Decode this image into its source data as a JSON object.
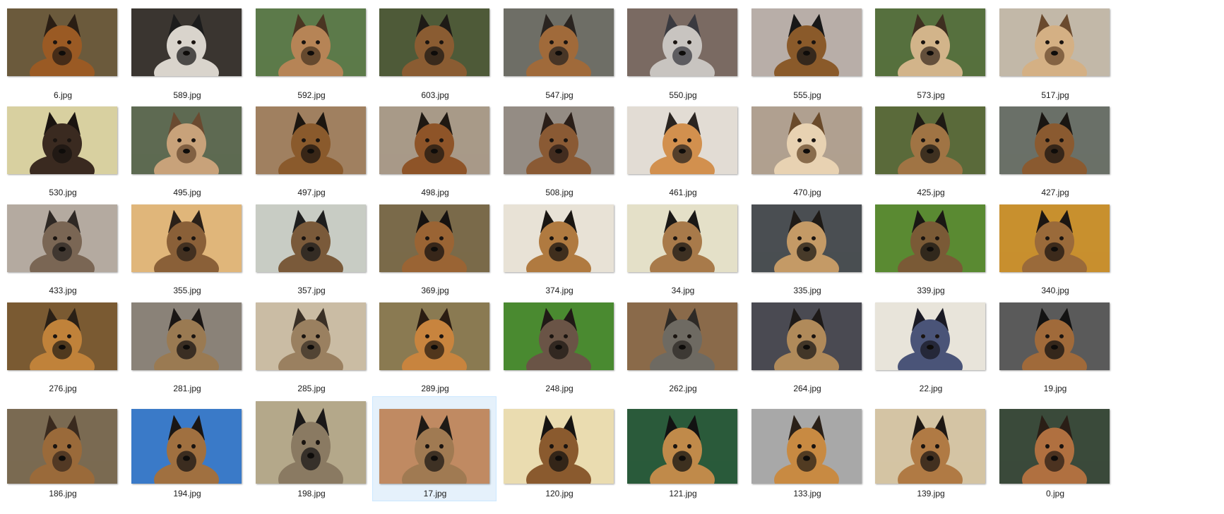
{
  "files": [
    {
      "name": "6.jpg",
      "bg": "#6b5a3c",
      "coat": "#9a5a24",
      "dark": "#2a1e14",
      "selected": false
    },
    {
      "name": "589.jpg",
      "bg": "#3a3530",
      "coat": "#d9d4cc",
      "dark": "#1c1c1c",
      "selected": false
    },
    {
      "name": "592.jpg",
      "bg": "#5c7a4a",
      "coat": "#b68456",
      "dark": "#4a3522",
      "selected": false
    },
    {
      "name": "603.jpg",
      "bg": "#4e5a38",
      "coat": "#8a5c32",
      "dark": "#1e1a16",
      "selected": false
    },
    {
      "name": "547.jpg",
      "bg": "#6e6e66",
      "coat": "#a06a3a",
      "dark": "#2a2420",
      "selected": false
    },
    {
      "name": "550.jpg",
      "bg": "#7a6a62",
      "coat": "#c8c4c0",
      "dark": "#3a3a40",
      "selected": false
    },
    {
      "name": "555.jpg",
      "bg": "#b8aea8",
      "coat": "#8a5a2a",
      "dark": "#181818",
      "selected": false
    },
    {
      "name": "573.jpg",
      "bg": "#56703e",
      "coat": "#d2b48a",
      "dark": "#3e2e20",
      "selected": false
    },
    {
      "name": "517.jpg",
      "bg": "#c2b8a8",
      "coat": "#d4b084",
      "dark": "#6a4a2e",
      "selected": false
    },
    {
      "name": "530.jpg",
      "bg": "#d8d0a0",
      "coat": "#3a2a20",
      "dark": "#1a1410",
      "selected": false
    },
    {
      "name": "495.jpg",
      "bg": "#5e6a52",
      "coat": "#c8a27a",
      "dark": "#6a4a30",
      "selected": false
    },
    {
      "name": "497.jpg",
      "bg": "#a08060",
      "coat": "#8a5a2c",
      "dark": "#1c1610",
      "selected": false
    },
    {
      "name": "498.jpg",
      "bg": "#a89a88",
      "coat": "#8e5428",
      "dark": "#1e1812",
      "selected": false
    },
    {
      "name": "508.jpg",
      "bg": "#948c84",
      "coat": "#8a5a34",
      "dark": "#2a1e18",
      "selected": false
    },
    {
      "name": "461.jpg",
      "bg": "#e2dcd4",
      "coat": "#d2904e",
      "dark": "#2a2420",
      "selected": false
    },
    {
      "name": "470.jpg",
      "bg": "#b0a090",
      "coat": "#e8d2b2",
      "dark": "#6a4a2a",
      "selected": false
    },
    {
      "name": "425.jpg",
      "bg": "#5a6a3a",
      "coat": "#a07444",
      "dark": "#1e1a14",
      "selected": false
    },
    {
      "name": "427.jpg",
      "bg": "#6a7068",
      "coat": "#8a5a30",
      "dark": "#1a1612",
      "selected": false
    },
    {
      "name": "433.jpg",
      "bg": "#b4aaa0",
      "coat": "#7a6654",
      "dark": "#2e2824",
      "selected": false
    },
    {
      "name": "355.jpg",
      "bg": "#e0b67a",
      "coat": "#8a6038",
      "dark": "#2a2018",
      "selected": false
    },
    {
      "name": "357.jpg",
      "bg": "#c8ccc4",
      "coat": "#7a5a3a",
      "dark": "#1e1e1e",
      "selected": false
    },
    {
      "name": "369.jpg",
      "bg": "#7a6a4a",
      "coat": "#9a6434",
      "dark": "#161210",
      "selected": false
    },
    {
      "name": "374.jpg",
      "bg": "#e8e2d6",
      "coat": "#b07a40",
      "dark": "#1a1612",
      "selected": false
    },
    {
      "name": "34.jpg",
      "bg": "#e4e0c8",
      "coat": "#a87a4a",
      "dark": "#1a1816",
      "selected": false
    },
    {
      "name": "335.jpg",
      "bg": "#4a4e52",
      "coat": "#c49a66",
      "dark": "#1e1a16",
      "selected": false
    },
    {
      "name": "339.jpg",
      "bg": "#5a8a32",
      "coat": "#7a5a36",
      "dark": "#1a1814",
      "selected": false
    },
    {
      "name": "340.jpg",
      "bg": "#c8902e",
      "coat": "#9a6a3a",
      "dark": "#1c1612",
      "selected": false
    },
    {
      "name": "276.jpg",
      "bg": "#7a5a32",
      "coat": "#c0823a",
      "dark": "#2a2016",
      "selected": false
    },
    {
      "name": "281.jpg",
      "bg": "#8a8278",
      "coat": "#9a7a52",
      "dark": "#1a1614",
      "selected": false
    },
    {
      "name": "285.jpg",
      "bg": "#cabca4",
      "coat": "#9a8060",
      "dark": "#3a3026",
      "selected": false
    },
    {
      "name": "289.jpg",
      "bg": "#8a7a52",
      "coat": "#c8843e",
      "dark": "#2a1c12",
      "selected": false
    },
    {
      "name": "248.jpg",
      "bg": "#4a8a30",
      "coat": "#6a5446",
      "dark": "#201a16",
      "selected": false
    },
    {
      "name": "262.jpg",
      "bg": "#8a6a4a",
      "coat": "#6e6a62",
      "dark": "#2e2a26",
      "selected": false
    },
    {
      "name": "264.jpg",
      "bg": "#4a4a52",
      "coat": "#b08a5a",
      "dark": "#1e1a18",
      "selected": false
    },
    {
      "name": "22.jpg",
      "bg": "#e8e4da",
      "coat": "#4a5478",
      "dark": "#1a1a24",
      "selected": false
    },
    {
      "name": "19.jpg",
      "bg": "#5a5a5a",
      "coat": "#a06a3a",
      "dark": "#121212",
      "selected": false
    },
    {
      "name": "186.jpg",
      "bg": "#7a6a52",
      "coat": "#9a6a3a",
      "dark": "#3a2a1e",
      "selected": false
    },
    {
      "name": "194.jpg",
      "bg": "#3a7ac8",
      "coat": "#a07040",
      "dark": "#1a1614",
      "selected": false
    },
    {
      "name": "198.jpg",
      "bg": "#b4a88a",
      "coat": "#8a7a62",
      "dark": "#1a1818",
      "selected": false
    },
    {
      "name": "17.jpg",
      "bg": "#c08a62",
      "coat": "#a07a52",
      "dark": "#1e1a16",
      "selected": true
    },
    {
      "name": "120.jpg",
      "bg": "#eadcb0",
      "coat": "#8a5a2e",
      "dark": "#161412",
      "selected": false
    },
    {
      "name": "121.jpg",
      "bg": "#2a5a3a",
      "coat": "#c08a4a",
      "dark": "#121212",
      "selected": false
    },
    {
      "name": "133.jpg",
      "bg": "#a8a8a8",
      "coat": "#c88a42",
      "dark": "#2a2018",
      "selected": false
    },
    {
      "name": "139.jpg",
      "bg": "#d4c4a4",
      "coat": "#b07a44",
      "dark": "#1e1814",
      "selected": false
    },
    {
      "name": "0.jpg",
      "bg": "#3a4a3a",
      "coat": "#b07040",
      "dark": "#2a1e16",
      "selected": false
    }
  ]
}
